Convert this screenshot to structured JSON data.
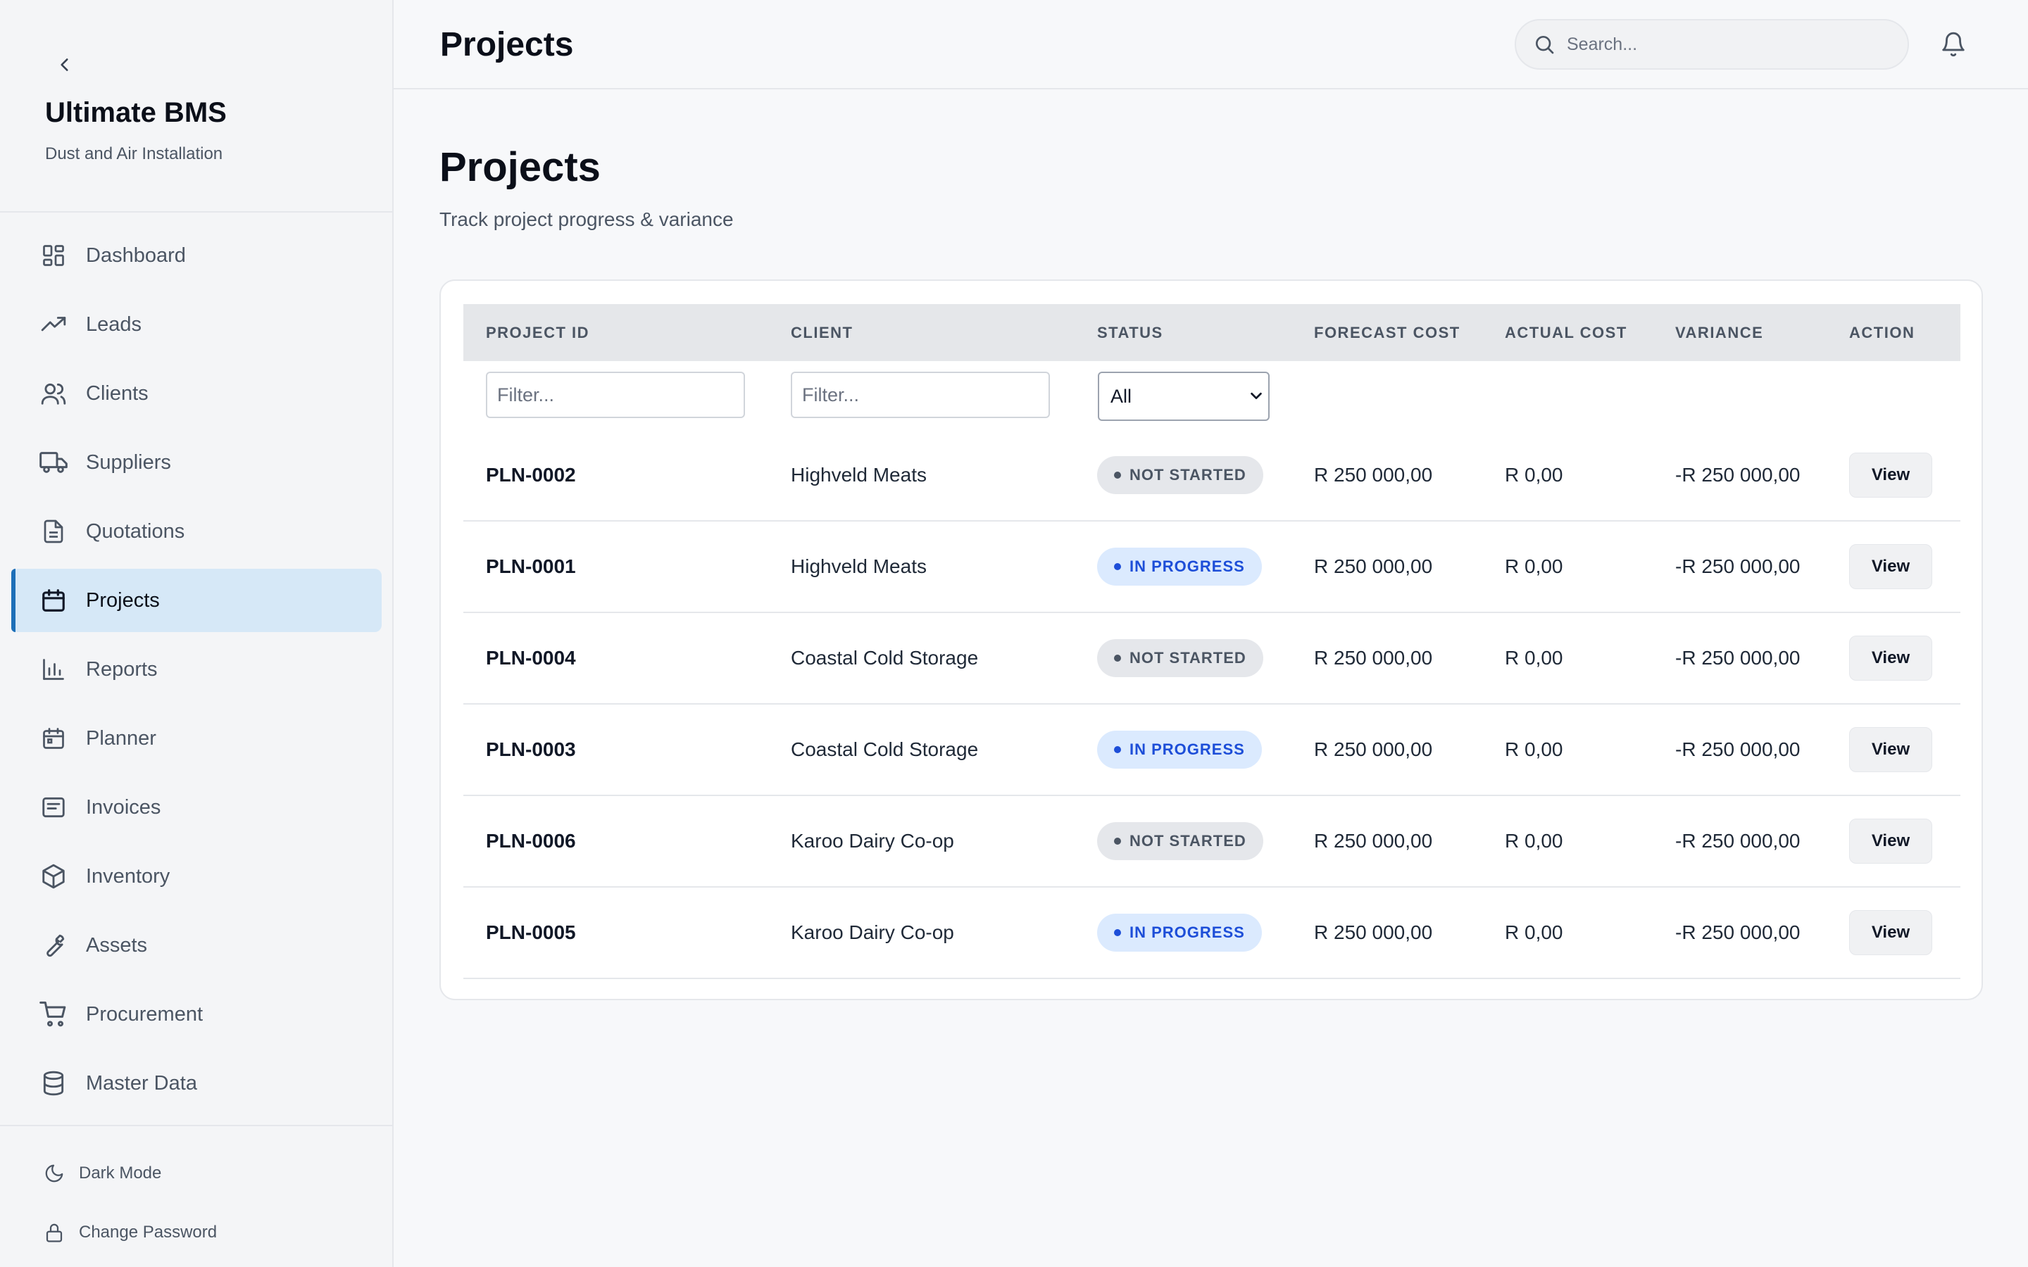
{
  "sidebar": {
    "brand_title": "Ultimate BMS",
    "brand_subtitle": "Dust and Air Installation",
    "items": [
      {
        "label": "Dashboard",
        "icon": "dashboard-icon"
      },
      {
        "label": "Leads",
        "icon": "trending-up-icon"
      },
      {
        "label": "Clients",
        "icon": "users-icon"
      },
      {
        "label": "Suppliers",
        "icon": "truck-icon"
      },
      {
        "label": "Quotations",
        "icon": "document-icon"
      },
      {
        "label": "Projects",
        "icon": "calendar-icon",
        "active": true
      },
      {
        "label": "Reports",
        "icon": "bar-chart-icon"
      },
      {
        "label": "Planner",
        "icon": "calendar-grid-icon"
      },
      {
        "label": "Invoices",
        "icon": "invoice-icon"
      },
      {
        "label": "Inventory",
        "icon": "box-icon"
      },
      {
        "label": "Assets",
        "icon": "wrench-icon"
      },
      {
        "label": "Procurement",
        "icon": "cart-icon"
      },
      {
        "label": "Master Data",
        "icon": "database-icon"
      }
    ],
    "dark_mode_label": "Dark Mode",
    "change_password_label": "Change Password"
  },
  "header": {
    "title": "Projects",
    "search_placeholder": "Search..."
  },
  "main": {
    "title": "Projects",
    "subtitle": "Track project progress & variance"
  },
  "table": {
    "columns": [
      "PROJECT ID",
      "CLIENT",
      "STATUS",
      "FORECAST COST",
      "ACTUAL COST",
      "VARIANCE",
      "ACTION"
    ],
    "filter_placeholder": "Filter...",
    "status_filter_value": "All",
    "rows": [
      {
        "id": "PLN-0002",
        "client": "Highveld Meats",
        "status": "NOT STARTED",
        "forecast": "R 250 000,00",
        "actual": "R 0,00",
        "variance": "-R 250 000,00",
        "action": "View"
      },
      {
        "id": "PLN-0001",
        "client": "Highveld Meats",
        "status": "IN PROGRESS",
        "forecast": "R 250 000,00",
        "actual": "R 0,00",
        "variance": "-R 250 000,00",
        "action": "View"
      },
      {
        "id": "PLN-0004",
        "client": "Coastal Cold Storage",
        "status": "NOT STARTED",
        "forecast": "R 250 000,00",
        "actual": "R 0,00",
        "variance": "-R 250 000,00",
        "action": "View"
      },
      {
        "id": "PLN-0003",
        "client": "Coastal Cold Storage",
        "status": "IN PROGRESS",
        "forecast": "R 250 000,00",
        "actual": "R 0,00",
        "variance": "-R 250 000,00",
        "action": "View"
      },
      {
        "id": "PLN-0006",
        "client": "Karoo Dairy Co-op",
        "status": "NOT STARTED",
        "forecast": "R 250 000,00",
        "actual": "R 0,00",
        "variance": "-R 250 000,00",
        "action": "View"
      },
      {
        "id": "PLN-0005",
        "client": "Karoo Dairy Co-op",
        "status": "IN PROGRESS",
        "forecast": "R 250 000,00",
        "actual": "R 0,00",
        "variance": "-R 250 000,00",
        "action": "View"
      }
    ]
  },
  "colors": {
    "accent": "#1d6fb8",
    "active_nav_bg": "#d6e8f7",
    "in_progress": "#1d4ed8",
    "not_started": "#4b5563"
  }
}
